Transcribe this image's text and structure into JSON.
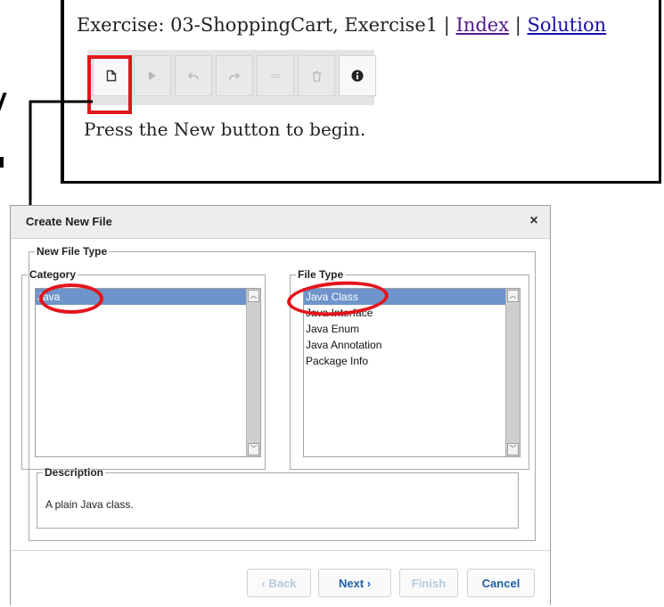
{
  "exercise": {
    "title_prefix": "Exercise: 03-ShoppingCart, Exercise1 | ",
    "separator": " | ",
    "index_link": "Index",
    "solution_link": "Solution",
    "hint": "Press the New button to begin."
  },
  "toolbar": {
    "buttons": [
      {
        "icon": "new-file-icon",
        "enabled": true
      },
      {
        "icon": "run-icon",
        "enabled": false
      },
      {
        "icon": "undo-icon",
        "enabled": false
      },
      {
        "icon": "redo-icon",
        "enabled": false
      },
      {
        "icon": "minus-icon",
        "enabled": false
      },
      {
        "icon": "trash-icon",
        "enabled": false
      },
      {
        "icon": "info-icon",
        "enabled": true
      }
    ]
  },
  "dialog": {
    "title": "Create New File",
    "close_symbol": "×",
    "new_file_type_legend": "New File Type",
    "category_legend": "Category",
    "file_type_legend": "File Type",
    "categories": [
      "Java"
    ],
    "selected_category": "Java",
    "file_types": [
      "Java Class",
      "Java Interface",
      "Java Enum",
      "Java Annotation",
      "Package Info"
    ],
    "selected_file_type": "Java Class",
    "description_legend": "Description",
    "description": "A plain Java class.",
    "buttons": {
      "back": "‹  Back",
      "next": "Next  ›",
      "finish": "Finish",
      "cancel": "Cancel"
    }
  },
  "colors": {
    "annotation_red": "#e3141c",
    "selection_blue": "#6e94cb",
    "link_blue": "#1a0dab",
    "link_visited": "#551a8b",
    "button_text_blue": "#1f5fa8"
  }
}
